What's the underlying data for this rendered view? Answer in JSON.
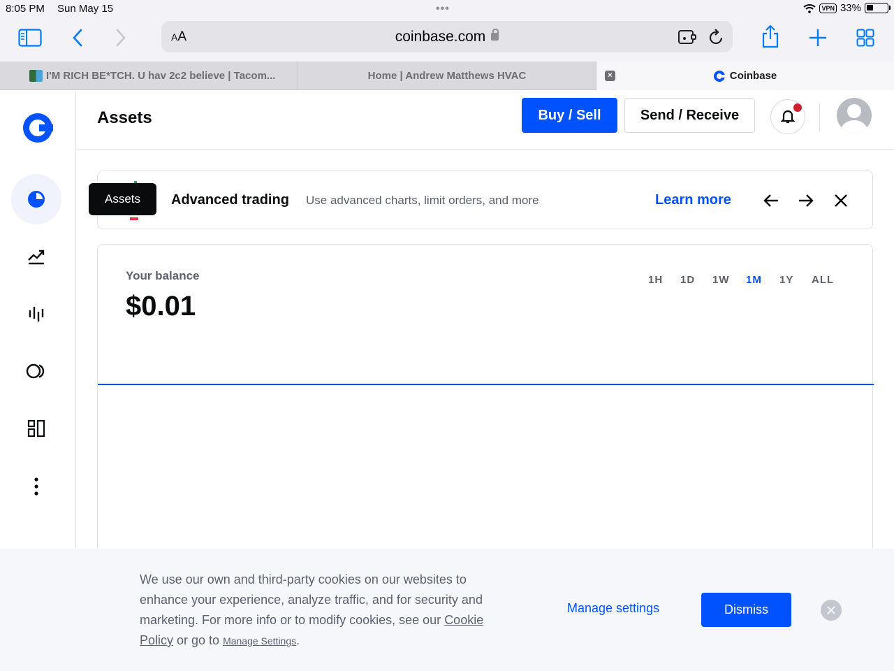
{
  "status_bar": {
    "time": "8:05 PM",
    "date": "Sun May 15",
    "vpn": "VPN",
    "battery": "33%",
    "battery_level": 0.33
  },
  "browser": {
    "url_aa_small": "A",
    "url_aa_large": "A",
    "url": "coinbase.com",
    "tabs": [
      {
        "label": "I'M RICH BE*TCH. U hav 2c2 believe | Tacom..."
      },
      {
        "label": "Home | Andrew Matthews HVAC"
      },
      {
        "label": "Coinbase",
        "close": "×"
      }
    ]
  },
  "header": {
    "title": "Assets",
    "buy_sell": "Buy / Sell",
    "send_receive": "Send / Receive"
  },
  "tooltip": "Assets",
  "promo": {
    "title": "Advanced trading",
    "description": "Use advanced charts, limit orders, and more",
    "link": "Learn more"
  },
  "balance": {
    "label": "Your balance",
    "value": "$0.01",
    "ranges": [
      "1H",
      "1D",
      "1W",
      "1M",
      "1Y",
      "ALL"
    ],
    "active_range": "1M"
  },
  "chart_data": {
    "type": "line",
    "x": [
      0,
      1
    ],
    "values": [
      0.01,
      0.01
    ],
    "color": "#0052ff"
  },
  "cookie": {
    "text_1": "We use our own and third-party cookies on our websites to enhance your experience, analyze traffic, and for security and marketing. For more info or to modify cookies, see our ",
    "cookie_policy": "Cookie Policy",
    "text_2": " or go to ",
    "manage_link": "Manage Settings",
    "text_3": ".",
    "manage_button": "Manage settings",
    "dismiss_button": "Dismiss"
  },
  "colors": {
    "brand": "#0052ff",
    "alert": "#cf202f"
  }
}
